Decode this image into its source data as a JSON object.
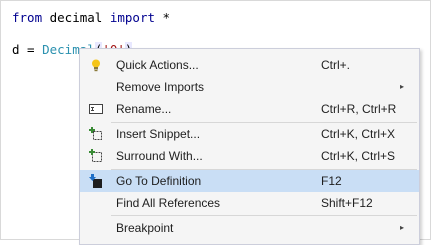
{
  "editor": {
    "line1": {
      "kw1": "from",
      "mod": " decimal ",
      "kw2": "import",
      "rest": " *"
    },
    "line2": {
      "pre": "d = ",
      "cls": "Decimal",
      "open": "(",
      "str": "'0'",
      "close": ")"
    }
  },
  "menu": {
    "items": [
      {
        "label": "Quick Actions...",
        "shortcut": "Ctrl+.",
        "icon": "lightbulb-icon"
      },
      {
        "label": "Remove Imports",
        "shortcut": "",
        "submenu_arrow": "▸"
      },
      {
        "label": "Rename...",
        "shortcut": "Ctrl+R, Ctrl+R",
        "icon": "rename-icon"
      },
      {
        "label": "Insert Snippet...",
        "shortcut": "Ctrl+K, Ctrl+X",
        "icon": "insert-snippet-icon"
      },
      {
        "label": "Surround With...",
        "shortcut": "Ctrl+K, Ctrl+S",
        "icon": "surround-with-icon"
      },
      {
        "label": "Go To Definition",
        "shortcut": "F12",
        "icon": "go-to-definition-icon",
        "highlighted": true
      },
      {
        "label": "Find All References",
        "shortcut": "Shift+F12"
      },
      {
        "label": "Breakpoint",
        "shortcut": "",
        "submenu_arrow": "▸"
      }
    ]
  },
  "colors": {
    "keyword": "#00008f",
    "class_name": "#2b91af",
    "string": "#a31515",
    "menu_background": "#f5f5f5",
    "menu_highlight": "#c9def5",
    "snippet_icon_green": "#388a34"
  }
}
